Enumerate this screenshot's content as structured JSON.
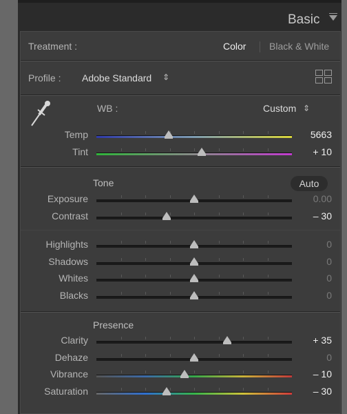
{
  "panel": {
    "title": "Basic"
  },
  "treatment": {
    "label": "Treatment :",
    "color": "Color",
    "bw": "Black & White"
  },
  "profile": {
    "label": "Profile :",
    "value": "Adobe Standard",
    "arrows": "⇕"
  },
  "wb": {
    "label": "WB :",
    "value": "Custom",
    "arrows": "⇕"
  },
  "wb_sliders": [
    {
      "label": "Temp",
      "value": "5663",
      "pos": 0.37
    },
    {
      "label": "Tint",
      "value": "+ 10",
      "pos": 0.54
    }
  ],
  "tone": {
    "label": "Tone",
    "auto": "Auto"
  },
  "tone_sliders": [
    {
      "label": "Exposure",
      "value": "0.00",
      "pos": 0.5
    },
    {
      "label": "Contrast",
      "value": "– 30",
      "pos": 0.36
    }
  ],
  "tone_sliders2": [
    {
      "label": "Highlights",
      "value": "0",
      "pos": 0.5
    },
    {
      "label": "Shadows",
      "value": "0",
      "pos": 0.5
    },
    {
      "label": "Whites",
      "value": "0",
      "pos": 0.5
    },
    {
      "label": "Blacks",
      "value": "0",
      "pos": 0.5
    }
  ],
  "presence": {
    "label": "Presence"
  },
  "presence_sliders": [
    {
      "label": "Clarity",
      "value": "+ 35",
      "pos": 0.67
    },
    {
      "label": "Dehaze",
      "value": "0",
      "pos": 0.5
    },
    {
      "label": "Vibrance",
      "value": "– 10",
      "pos": 0.45
    },
    {
      "label": "Saturation",
      "value": "– 30",
      "pos": 0.36
    }
  ],
  "colors": {
    "bright_value": "#f0f0f0",
    "dim_value": "#7a7a7a"
  }
}
